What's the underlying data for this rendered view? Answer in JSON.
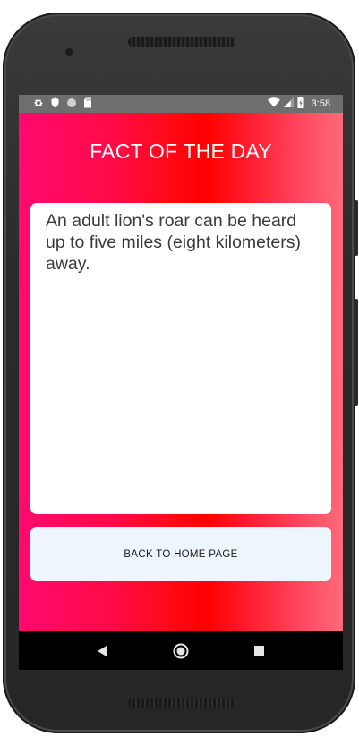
{
  "status_bar": {
    "time": "3:58",
    "left_icons": [
      "settings-icon",
      "shield-icon",
      "circle-icon",
      "sd-card-icon"
    ],
    "right_icons": [
      "wifi-icon",
      "signal-icon",
      "battery-icon"
    ]
  },
  "app": {
    "title": "FACT OF THE DAY",
    "fact_text": "An adult lion's roar can be heard up to five miles (eight kilometers) away.",
    "back_button_label": "BACK TO HOME PAGE"
  },
  "nav_bar": {
    "buttons": [
      "back-icon",
      "home-icon",
      "recents-icon"
    ]
  },
  "colors": {
    "gradient_left": "#ff0a6e",
    "gradient_mid": "#ff0000",
    "gradient_right": "#ff6a78",
    "button_bg": "#eef5fd",
    "status_bar_bg": "#6e6e6e"
  }
}
